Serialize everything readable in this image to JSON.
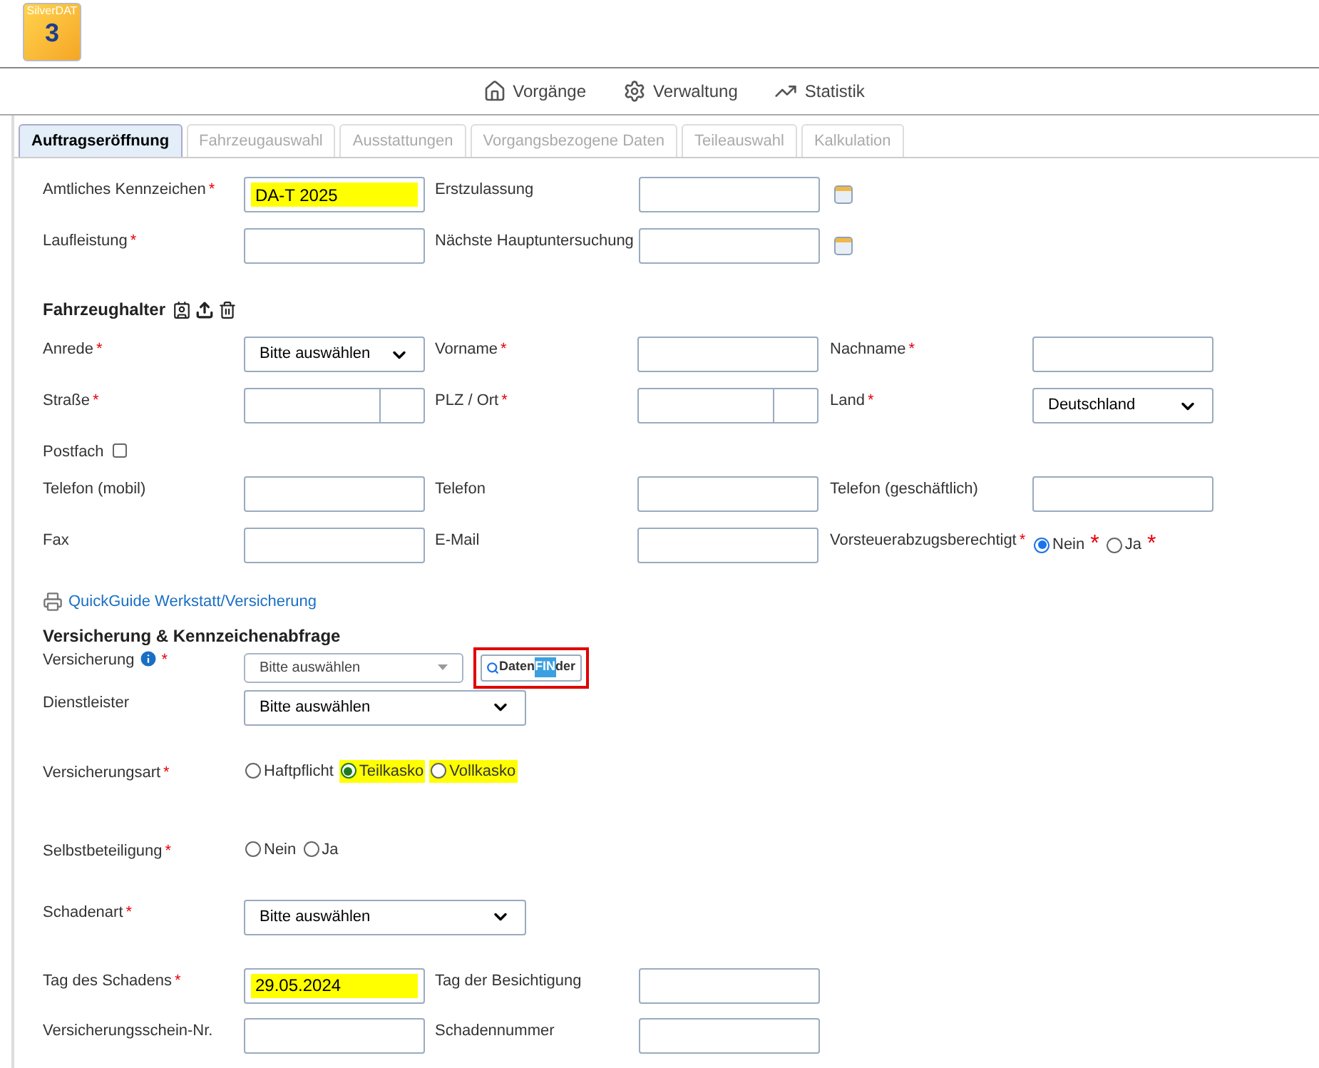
{
  "logo": {
    "brand": "SilverDAT",
    "version": "3"
  },
  "nav": [
    {
      "label": "Vorgänge"
    },
    {
      "label": "Verwaltung"
    },
    {
      "label": "Statistik"
    }
  ],
  "tabs": [
    {
      "label": "Auftragseröffnung",
      "selected": true
    },
    {
      "label": "Fahrzeugauswahl",
      "selected": false
    },
    {
      "label": "Ausstattungen",
      "selected": false
    },
    {
      "label": "Vorgangsbezogene Daten",
      "selected": false
    },
    {
      "label": "Teileauswahl",
      "selected": false
    },
    {
      "label": "Kalkulation",
      "selected": false
    }
  ],
  "vehicle": {
    "rows": [
      [
        {
          "label": "Amtliches Kennzeichen",
          "mark": "*",
          "kind": "text",
          "value": "DA-T 2025",
          "highlighted": true
        },
        {
          "label": "Erstzulassung",
          "kind": "date"
        }
      ],
      [
        {
          "label": "Laufleistung",
          "mark": "*",
          "kind": "text"
        },
        {
          "label": "Nächste Hauptuntersuchung",
          "kind": "date"
        }
      ]
    ]
  },
  "holder": {
    "title": "Fahrzeughalter",
    "rows": [
      [
        {
          "label": "Anrede",
          "mark": "*",
          "kind": "select",
          "value": "Bitte auswählen"
        },
        {
          "label": "Vorname",
          "mark": "*",
          "kind": "text"
        },
        {
          "label": "Nachname",
          "mark": "*",
          "kind": "text"
        }
      ],
      [
        {
          "label": "Straße",
          "mark": "*",
          "kind": "split"
        },
        {
          "label": "PLZ / Ort",
          "mark": "*",
          "kind": "split"
        },
        {
          "label": "Land",
          "mark": "*",
          "kind": "select",
          "value": "Deutschland"
        }
      ],
      [
        {
          "label": "Postfach",
          "kind": "checkbox",
          "checked": false
        }
      ],
      [
        {
          "label": "Telefon (mobil)",
          "kind": "text"
        },
        {
          "label": "Telefon",
          "kind": "text"
        },
        {
          "label": "Telefon (geschäftlich)",
          "kind": "text"
        }
      ],
      [
        {
          "label": "Fax",
          "kind": "text"
        },
        {
          "label": "E-Mail",
          "kind": "text"
        },
        {
          "label": "Vorsteuerabzugsberechtigt",
          "mark": "*",
          "kind": "radio",
          "options": [
            {
              "label": "Nein",
              "mark": "*",
              "selected": true,
              "highlighted": false
            },
            {
              "label": "Ja",
              "mark": "*",
              "selected": false,
              "highlighted": false
            }
          ]
        }
      ]
    ]
  },
  "quickguide": {
    "label": "QuickGuide Werkstatt/Versicherung"
  },
  "insurance": {
    "title": "Versicherung & Kennzeichenabfrage",
    "finder": {
      "parts": [
        "Daten",
        "FIN",
        "der"
      ]
    },
    "rows": [
      [
        {
          "label": "Versicherung",
          "mark": "*",
          "info": true,
          "kind": "combo",
          "value": "Bitte auswählen"
        }
      ],
      [
        {
          "label": "Dienstleister",
          "kind": "select",
          "value": "Bitte auswählen"
        }
      ],
      [
        {
          "label": "Versicherungsart",
          "mark": "*",
          "kind": "radio",
          "options": [
            {
              "label": "Haftpflicht",
              "selected": false,
              "highlighted": false
            },
            {
              "label": "Teilkasko",
              "selected": true,
              "highlighted": true
            },
            {
              "label": "Vollkasko",
              "selected": false,
              "highlighted": true
            }
          ]
        }
      ],
      [
        {
          "label": "Selbstbeteiligung",
          "mark": "*",
          "kind": "radio",
          "options": [
            {
              "label": "Nein",
              "selected": false,
              "highlighted": false
            },
            {
              "label": "Ja",
              "selected": false,
              "highlighted": false
            }
          ]
        }
      ],
      [
        {
          "label": "Schadenart",
          "mark": "*",
          "kind": "select",
          "value": "Bitte auswählen"
        }
      ],
      [
        {
          "label": "Tag des Schadens",
          "mark": "*",
          "kind": "text",
          "value": "29.05.2024",
          "highlighted": true
        },
        {
          "label": "Tag der Besichtigung",
          "kind": "text"
        }
      ],
      [
        {
          "label": "Versicherungsschein-Nr.",
          "kind": "text"
        },
        {
          "label": "Schadennummer",
          "kind": "text"
        }
      ]
    ]
  }
}
